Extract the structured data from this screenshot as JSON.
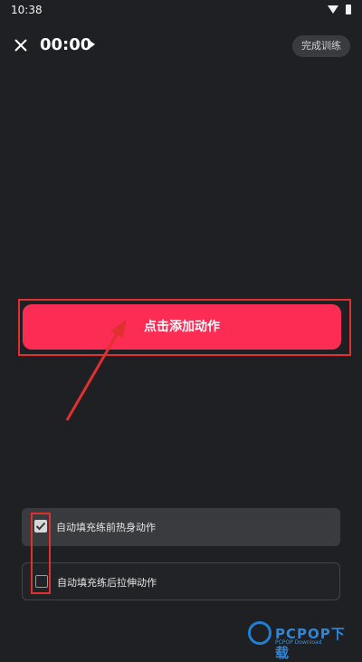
{
  "status_bar": {
    "time": "10:38"
  },
  "top_bar": {
    "timer": "00:00",
    "finish_label": "完成训练"
  },
  "main": {
    "add_action_label": "点击添加动作"
  },
  "options": [
    {
      "label": "自动填充练前热身动作",
      "checked": true
    },
    {
      "label": "自动填充练后拉伸动作",
      "checked": false
    }
  ],
  "watermark": {
    "text": "PCPOP下载",
    "sub": "PCPOP Download"
  },
  "colors": {
    "accent": "#fc2c54",
    "background": "#1f2023",
    "annotation": "#e03030",
    "watermark": "#2f86d8"
  }
}
